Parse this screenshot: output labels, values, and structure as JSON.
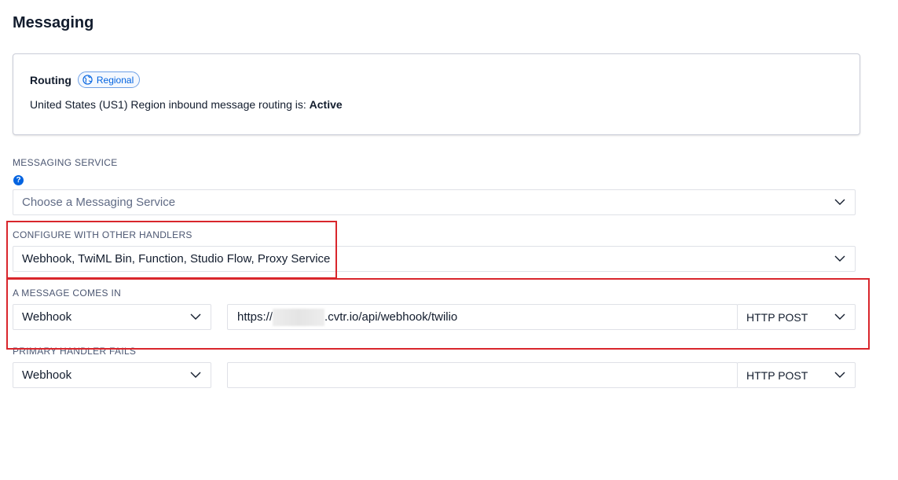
{
  "page": {
    "title": "Messaging"
  },
  "routing": {
    "title": "Routing",
    "badge": "Regional",
    "status_prefix": "United States (US1) Region inbound message routing is: ",
    "status_value": "Active"
  },
  "messaging_service": {
    "label": "MESSAGING SERVICE",
    "help": "?",
    "placeholder": "Choose a Messaging Service"
  },
  "other_handlers": {
    "label": "CONFIGURE WITH OTHER HANDLERS",
    "value": "Webhook, TwiML Bin, Function, Studio Flow, Proxy Service"
  },
  "message_comes_in": {
    "label": "A MESSAGE COMES IN",
    "type": "Webhook",
    "url_prefix": "https://",
    "url_suffix": ".cvtr.io/api/webhook/twilio",
    "method": "HTTP POST"
  },
  "primary_handler_fails": {
    "label": "PRIMARY HANDLER FAILS",
    "type": "Webhook",
    "url": "",
    "method": "HTTP POST"
  },
  "colors": {
    "annotation_red": "#d9262c",
    "link_blue": "#0263e0"
  },
  "icons": {
    "badge": "globe-icon",
    "help": "help-icon",
    "dropdown": "chevron-down-icon"
  }
}
